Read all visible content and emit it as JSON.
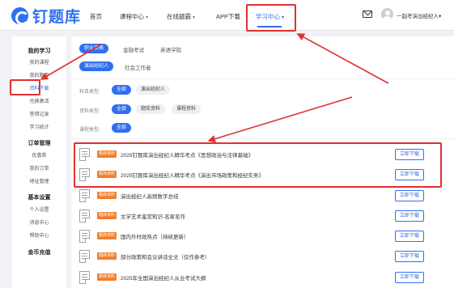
{
  "header": {
    "logo_text": "钉题库",
    "nav": [
      {
        "label": "首页",
        "has_caret": false
      },
      {
        "label": "课程中心",
        "has_caret": true
      },
      {
        "label": "在线题霸",
        "has_caret": true
      },
      {
        "label": "APP下载",
        "has_caret": false
      },
      {
        "label": "学习中心",
        "has_caret": true
      }
    ],
    "active_nav": "学习中心",
    "user_name": "一起考演出经纪人",
    "caret": "▾"
  },
  "sidebar": {
    "group_1": "我的学习",
    "my_courses": "我的课程",
    "my_questions": "我的题库",
    "downloads": "资料下载",
    "redeem": "兑换激活",
    "answer_records": "答错记录",
    "study_stats": "学习统计",
    "group_2": "订单管理",
    "coupons": "优惠券",
    "my_orders": "我的订单",
    "address": "地址管理",
    "group_3": "基本设置",
    "profile": "个人设置",
    "messages": "消息中心",
    "help": "帮助中心",
    "group_4": "金币充值"
  },
  "main": {
    "top_tabs": [
      "职业资格",
      "金融考试",
      "英语学院"
    ],
    "sub_tabs": [
      "演出经纪人",
      "社会工作者"
    ],
    "filters": {
      "subject_label": "科目类型:",
      "subject_options": [
        "全部",
        "演出经纪人"
      ],
      "material_label": "资料类型:",
      "material_options": [
        "全部",
        "题库资料",
        "课程资料"
      ],
      "course_label": "课程类型:",
      "course_options": [
        "全部"
      ]
    },
    "badge": "题库资料",
    "download_label": "立即下载",
    "rows": [
      {
        "title": "2025钉题库演出经纪人精华考点《思想政治与法律基础》"
      },
      {
        "title": "2025钉题库演出经纪人精华考点《演出市场政策和经纪实务》"
      },
      {
        "title": "演出经纪人高频数字总结"
      },
      {
        "title": "文学艺术鉴赏知识-名家名作"
      },
      {
        "title": "国内外时政热点（持续更新）"
      },
      {
        "title": "部分政策和会议讲话全文（仅作参考）"
      },
      {
        "title": "2025年全国演出经纪人从业考试大纲"
      }
    ]
  },
  "annotations": {
    "color": "#e03131"
  },
  "colors": {
    "accent": "#2f6ff0",
    "badge": "#f07f2a"
  }
}
